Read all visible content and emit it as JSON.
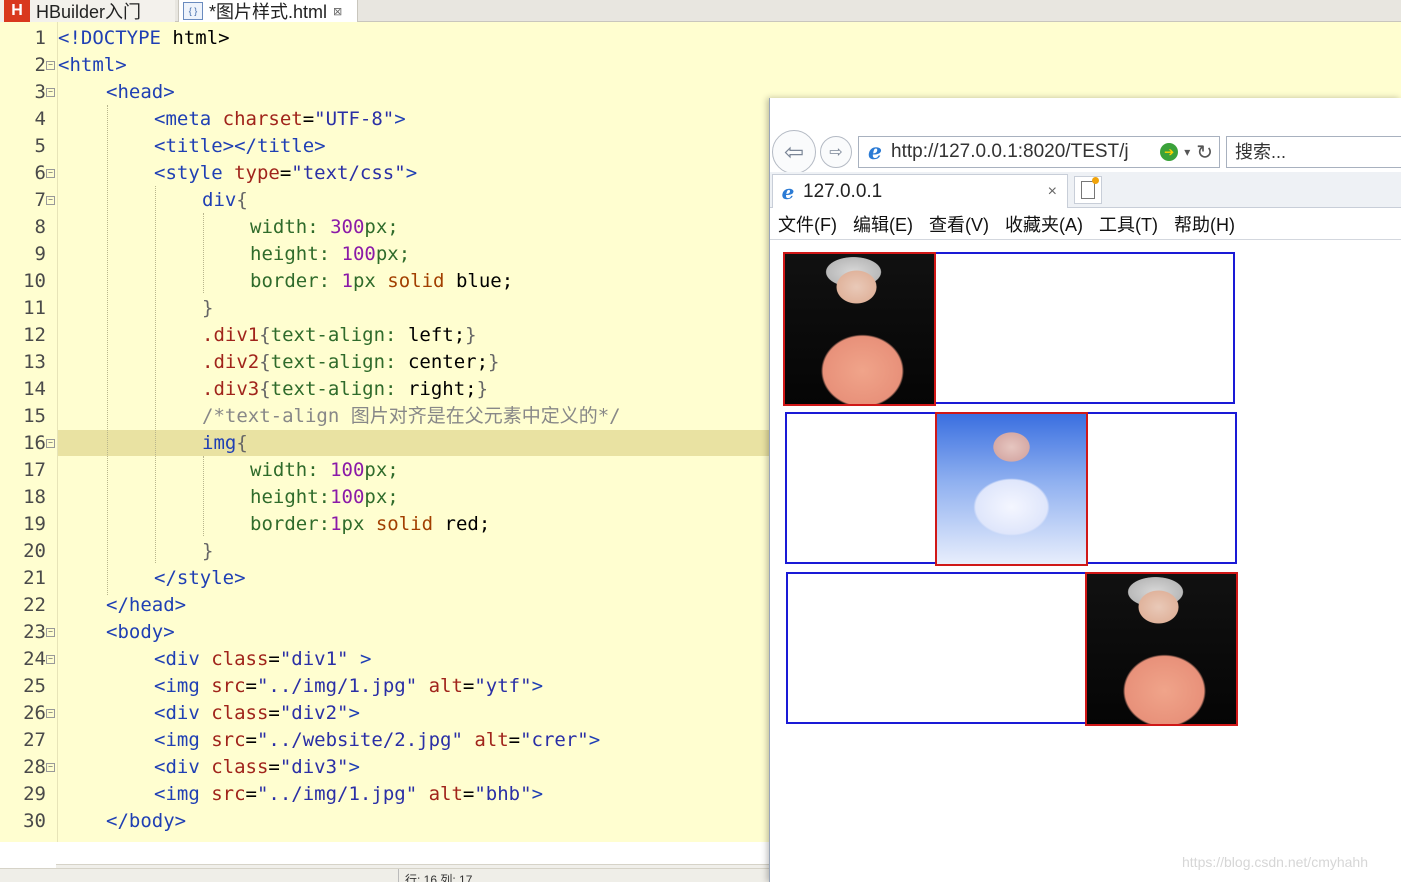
{
  "editor_tabs": [
    {
      "label": "HBuilder入门",
      "icon": "hbuilder-logo"
    },
    {
      "label": "*图片样式.html",
      "icon": "html-file-icon",
      "close": "⊠"
    }
  ],
  "code_lines": [
    {
      "n": "1",
      "fold": false
    },
    {
      "n": "2",
      "fold": true
    },
    {
      "n": "3",
      "fold": true
    },
    {
      "n": "4",
      "fold": false
    },
    {
      "n": "5",
      "fold": false
    },
    {
      "n": "6",
      "fold": true
    },
    {
      "n": "7",
      "fold": true
    },
    {
      "n": "8",
      "fold": false
    },
    {
      "n": "9",
      "fold": false
    },
    {
      "n": "10",
      "fold": false
    },
    {
      "n": "11",
      "fold": false
    },
    {
      "n": "12",
      "fold": false
    },
    {
      "n": "13",
      "fold": false
    },
    {
      "n": "14",
      "fold": false
    },
    {
      "n": "15",
      "fold": false
    },
    {
      "n": "16",
      "fold": true
    },
    {
      "n": "17",
      "fold": false
    },
    {
      "n": "18",
      "fold": false
    },
    {
      "n": "19",
      "fold": false
    },
    {
      "n": "20",
      "fold": false
    },
    {
      "n": "21",
      "fold": false
    },
    {
      "n": "22",
      "fold": false
    },
    {
      "n": "23",
      "fold": true
    },
    {
      "n": "24",
      "fold": true
    },
    {
      "n": "25",
      "fold": false
    },
    {
      "n": "26",
      "fold": true
    },
    {
      "n": "27",
      "fold": false
    },
    {
      "n": "28",
      "fold": true
    },
    {
      "n": "29",
      "fold": false
    },
    {
      "n": "30",
      "fold": false
    }
  ],
  "code": {
    "l1": [
      "<!DOCTYPE",
      " html>"
    ],
    "l2": [
      "<html>"
    ],
    "l3": [
      "<head>"
    ],
    "l4": [
      "<meta",
      " charset",
      "=",
      "\"UTF-8\"",
      ">"
    ],
    "l5": [
      "<title></title>"
    ],
    "l6": [
      "<style",
      " type",
      "=",
      "\"text/css\"",
      ">"
    ],
    "l7": [
      "div",
      "{"
    ],
    "l8": [
      "width: ",
      "300",
      "px;"
    ],
    "l9": [
      "height: ",
      "100",
      "px;"
    ],
    "l10": [
      "border: ",
      "1",
      "px ",
      "solid",
      " blue;"
    ],
    "l11": [
      "}"
    ],
    "l12": [
      ".div1",
      "{",
      "text-align: ",
      "left;",
      "}"
    ],
    "l13": [
      ".div2",
      "{",
      "text-align: ",
      "center;",
      "}"
    ],
    "l14": [
      ".div3",
      "{",
      "text-align: ",
      "right;",
      "}"
    ],
    "l15": [
      "/*text-align 图片对齐是在父元素中定义的*/"
    ],
    "l16": [
      "img",
      "{"
    ],
    "l17": [
      "width: ",
      "100",
      "px;"
    ],
    "l18": [
      "height:",
      "100",
      "px;"
    ],
    "l19": [
      "border:",
      "1",
      "px ",
      "solid",
      " red;"
    ],
    "l20": [
      "}"
    ],
    "l21": [
      "</style>"
    ],
    "l22": [
      "</head>"
    ],
    "l23": [
      "<body>"
    ],
    "l24": [
      "<div",
      " class",
      "=",
      "\"div1\"",
      " >"
    ],
    "l25": [
      "<img",
      " src",
      "=",
      "\"../img/1.jpg\"",
      " alt",
      "=",
      "\"ytf\"",
      ">"
    ],
    "l26": [
      "<div",
      " class",
      "=",
      "\"div2\"",
      ">"
    ],
    "l27": [
      "<img",
      " src",
      "=",
      "\"../website/2.jpg\"",
      " alt",
      "=",
      "\"crer\"",
      ">"
    ],
    "l28": [
      "<div",
      " class",
      "=",
      "\"div3\"",
      ">"
    ],
    "l29": [
      "<img",
      " src",
      "=",
      "\"../img/1.jpg\"",
      " alt",
      "=",
      "\"bhb\"",
      ">"
    ],
    "l30": [
      "</body>"
    ]
  },
  "status": {
    "position": "行: 16 列: 17"
  },
  "browser": {
    "address_url": "http://127.0.0.1:8020/TEST/j",
    "search_placeholder": "搜索...",
    "tab_title": "127.0.0.1",
    "tab_close": "×",
    "menu": [
      "文件(F)",
      "编辑(E)",
      "查看(V)",
      "收藏夹(A)",
      "工具(T)",
      "帮助(H)"
    ],
    "boxes": [
      {
        "class": "div1",
        "align": "left",
        "img_alt": "ytf"
      },
      {
        "class": "div2",
        "align": "center",
        "img_alt": "crer"
      },
      {
        "class": "div3",
        "align": "right",
        "img_alt": "bhb"
      }
    ]
  },
  "colors": {
    "editor_bg": "#fffed0",
    "box_border": "#1a1ad6",
    "img_border": "#d01818"
  },
  "watermark": "https://blog.csdn.net/cmyhahh"
}
